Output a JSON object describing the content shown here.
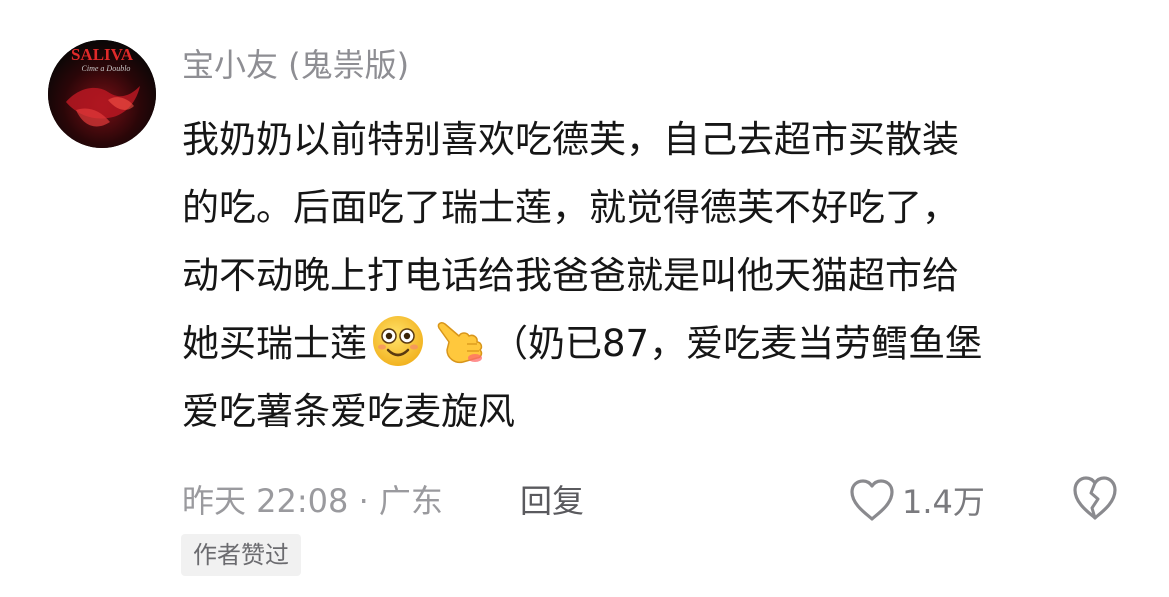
{
  "comment": {
    "username": "宝小友 (鬼祟版)",
    "avatar_text": {
      "line1": "SALIVA",
      "line2": "Cime a Doublo"
    },
    "content_lines": [
      {
        "text": "我奶奶以前特别喜欢吃德芙，自己去超市买散装"
      },
      {
        "text": "的吃。后面吃了瑞士莲，就觉得德芙不好吃了，"
      },
      {
        "text": "动不动晚上打电话给我爸爸就是叫他天猫超市给"
      },
      {
        "before": "她买瑞士莲",
        "emojis": [
          "smiling-face-emoji",
          "pointing-hand-emoji"
        ],
        "after": "（奶已87，爱吃麦当劳鳕鱼堡"
      },
      {
        "text": "爱吃薯条爱吃麦旋风"
      }
    ],
    "meta": "昨天 22:08 · 广东",
    "reply_label": "回复",
    "like_icon": "heart-outline-icon",
    "like_count": "1.4万",
    "dislike_icon": "broken-heart-icon",
    "author_badge": "作者赞过"
  },
  "colors": {
    "username": "#8e8e93",
    "content": "#161616",
    "meta": "#9a9a9e",
    "reply": "#5a5a5e",
    "badge_bg": "#f1f1f1",
    "avatar_accent": "#c8202a"
  }
}
